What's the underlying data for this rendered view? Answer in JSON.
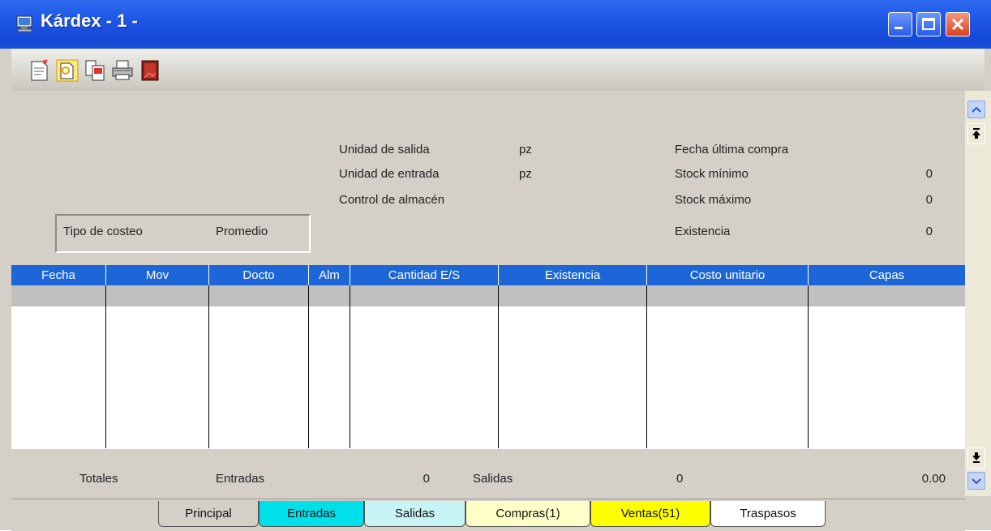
{
  "window": {
    "title": "Kárdex - 1 -",
    "icon": "app-monitor-icon"
  },
  "toolbar": {
    "tools": [
      "new-document-icon",
      "open-document-icon",
      "copy-document-icon",
      "print-icon",
      "exit-door-icon"
    ]
  },
  "info": {
    "unidad_salida": {
      "label": "Unidad de salida",
      "value": "pz"
    },
    "unidad_entrada": {
      "label": "Unidad de entrada",
      "value": "pz"
    },
    "control_almacen": {
      "label": "Control de almacén"
    },
    "fecha_ultima_compra": {
      "label": "Fecha última compra"
    },
    "stock_minimo": {
      "label": "Stock mínimo",
      "value": "0"
    },
    "stock_maximo": {
      "label": "Stock máximo",
      "value": "0"
    },
    "existencia": {
      "label": "Existencia",
      "value": "0"
    },
    "tipo_costeo": {
      "label": "Tipo de costeo",
      "value": "Promedio"
    }
  },
  "grid": {
    "columns": [
      "Fecha",
      "Mov",
      "Docto",
      "Alm",
      "Cantidad E/S",
      "Existencia",
      "Costo unitario",
      "Capas"
    ],
    "rows": []
  },
  "totals": {
    "label": "Totales",
    "entradas_label": "Entradas",
    "entradas_value": "0",
    "salidas_label": "Salidas",
    "salidas_value": "0",
    "total_value": "0.00"
  },
  "tabs": [
    {
      "label": "Principal",
      "color": "#d4d0c8"
    },
    {
      "label": "Entradas",
      "color": "#00e0e8"
    },
    {
      "label": "Salidas",
      "color": "#c8f4f6"
    },
    {
      "label": "Compras(1)",
      "color": "#ffffc8"
    },
    {
      "label": "Ventas(51)",
      "color": "#ffff00"
    },
    {
      "label": "Traspasos",
      "color": "#ffffff"
    }
  ],
  "colors": {
    "titlebar": "#1e56e6",
    "grid_header": "#1c66d8",
    "panel": "#d4d0c8"
  }
}
